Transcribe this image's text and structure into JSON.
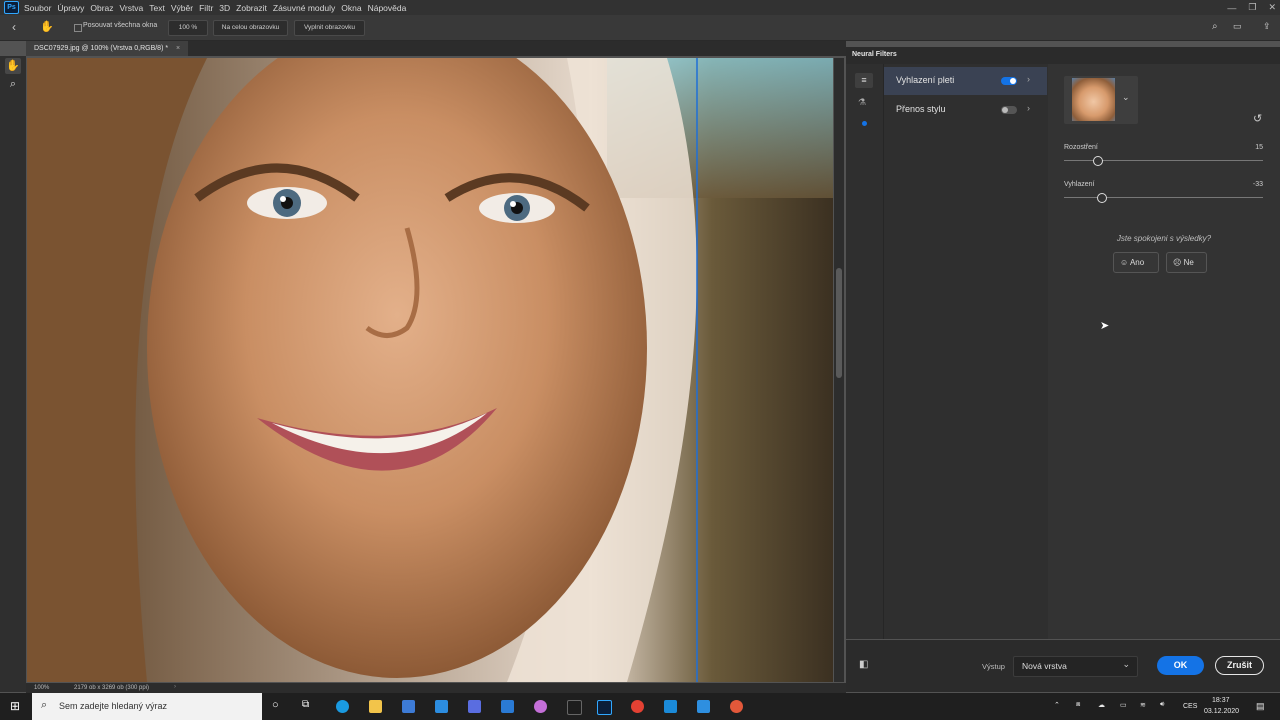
{
  "menu": {
    "logo": "Ps",
    "items": [
      "Soubor",
      "Úpravy",
      "Obraz",
      "Vrstva",
      "Text",
      "Výběr",
      "Filtr",
      "3D",
      "Zobrazit",
      "Zásuvné moduly",
      "Okna",
      "Nápověda"
    ]
  },
  "options_bar": {
    "scroll_all": "Posouvat všechna okna",
    "zoom": "100 %",
    "fit_screen": "Na celou obrazovku",
    "fill_screen": "Vyplnit obrazovku"
  },
  "document": {
    "tab_title": "DSC07929.jpg @ 100% (Vrstva 0,RGB/8) *",
    "zoom": "100%",
    "dimensions": "2179 ob x 3269 ob (300 ppi)"
  },
  "panel": {
    "title": "Neural Filters",
    "filters": [
      {
        "label": "Vyhlazení pleti",
        "enabled": true
      },
      {
        "label": "Přenos stylu",
        "enabled": false
      }
    ],
    "settings": {
      "sliders": [
        {
          "label": "Rozostření",
          "value": "15",
          "fraction": 0.17
        },
        {
          "label": "Vyhlazení",
          "value": "-33",
          "fraction": 0.19
        }
      ],
      "question": "Jste spokojeni s výsledky?",
      "yes": "Ano",
      "no": "Ne"
    },
    "footer": {
      "output_label": "Výstup",
      "output_value": "Nová vrstva",
      "ok": "OK",
      "cancel": "Zrušit"
    }
  },
  "taskbar": {
    "search_placeholder": "Sem zadejte hledaný výraz",
    "lang": "CES",
    "time": "18:37",
    "date": "03.12.2020"
  },
  "colors": {
    "accent": "#1473e6",
    "panel_bg": "#333333",
    "active_filter_bg": "#3a4253"
  }
}
